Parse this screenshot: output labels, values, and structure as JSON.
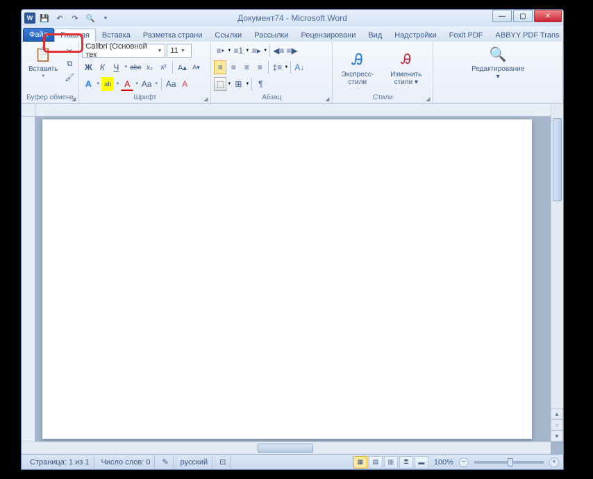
{
  "title": "Документ74  -  Microsoft Word",
  "word_icon_letter": "W",
  "tabs": {
    "file": "Файл",
    "items": [
      "Главная",
      "Вставка",
      "Разметка страни",
      "Ссылки",
      "Рассылки",
      "Рецензировани",
      "Вид",
      "Надстройки",
      "Foxit PDF",
      "ABBYY PDF Trans"
    ]
  },
  "help_symbol": "?",
  "minimize_ribbon_symbol": "ᐱ",
  "ribbon": {
    "clipboard": {
      "paste_label": "Вставить",
      "group_label": "Буфер обмена"
    },
    "font": {
      "font_name": "Calibri (Основной тек",
      "font_size": "11",
      "group_label": "Шрифт",
      "bold": "Ж",
      "italic": "К",
      "underline": "Ч",
      "strike": "abc",
      "sub": "x₂",
      "sup": "x²",
      "text_effects": "A",
      "highlight": "ab",
      "font_color": "A",
      "grow": "Aa",
      "case": "Aа",
      "clear": "A"
    },
    "paragraph": {
      "group_label": "Абзац"
    },
    "styles": {
      "quick_label": "Экспресс-стили",
      "change_label": "Изменить стили",
      "group_label": "Стили"
    },
    "editing": {
      "label": "Редактирование"
    }
  },
  "statusbar": {
    "page": "Страница: 1 из 1",
    "words": "Число слов: 0",
    "language": "русский",
    "zoom": "100%"
  }
}
